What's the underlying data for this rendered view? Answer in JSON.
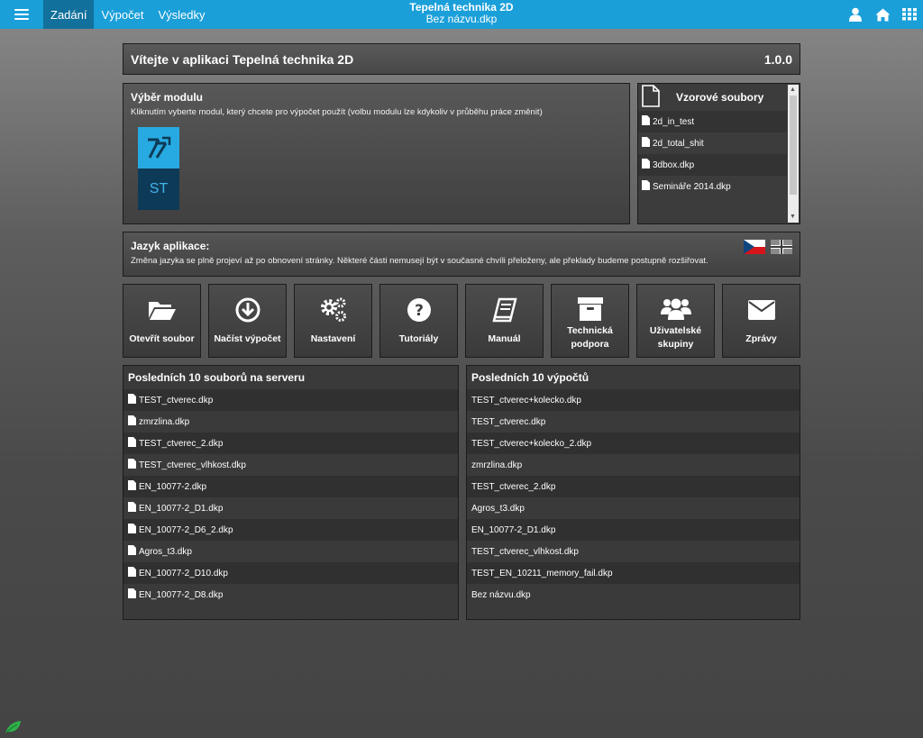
{
  "topbar": {
    "tabs": [
      {
        "label": "Zadání"
      },
      {
        "label": "Výpočet"
      },
      {
        "label": "Výsledky"
      }
    ],
    "title": "Tepelná technika 2D",
    "subtitle": "Bez názvu.dkp",
    "icons": [
      "user-icon",
      "home-icon",
      "grid-icon"
    ]
  },
  "welcome": {
    "title": "Vítejte v aplikaci Tepelná technika 2D",
    "version": "1.0.0"
  },
  "modules": {
    "title": "Výběr modulu",
    "description": "Kliknutím vyberte modul, který chcete pro výpočet použít (volbu modulu lze kdykoliv v průběhu práce změnit)",
    "tile_label": "ST"
  },
  "samples": {
    "title": "Vzorové soubory",
    "items": [
      {
        "name": "2d_in_test"
      },
      {
        "name": "2d_total_shit"
      },
      {
        "name": "3dbox.dkp"
      },
      {
        "name": "Semináře 2014.dkp"
      }
    ]
  },
  "language": {
    "title": "Jazyk aplikace:",
    "description": "Změna jazyka se plně projeví až po obnovení stránky. Některé části nemusejí být v současné chvíli přeloženy, ale překlady budeme postupně rozšiřovat."
  },
  "buttons": [
    {
      "label": "Otevřít soubor",
      "icon": "folder-open-icon"
    },
    {
      "label": "Načíst výpočet",
      "icon": "download-circle-icon"
    },
    {
      "label": "Nastavení",
      "icon": "gears-icon"
    },
    {
      "label": "Tutoriály",
      "icon": "question-circle-icon"
    },
    {
      "label": "Manuál",
      "icon": "book-icon"
    },
    {
      "label": "Technická podpora",
      "icon": "archive-box-icon"
    },
    {
      "label": "Uživatelské skupiny",
      "icon": "users-icon"
    },
    {
      "label": "Zprávy",
      "icon": "envelope-icon"
    }
  ],
  "recent_files": {
    "title": "Posledních 10 souborů na serveru",
    "items": [
      {
        "name": "TEST_ctverec.dkp"
      },
      {
        "name": "zmrzlina.dkp"
      },
      {
        "name": "TEST_ctverec_2.dkp"
      },
      {
        "name": "TEST_ctverec_vlhkost.dkp"
      },
      {
        "name": "EN_10077-2.dkp"
      },
      {
        "name": "EN_10077-2_D1.dkp"
      },
      {
        "name": "EN_10077-2_D6_2.dkp"
      },
      {
        "name": "Agros_t3.dkp"
      },
      {
        "name": "EN_10077-2_D10.dkp"
      },
      {
        "name": "EN_10077-2_D8.dkp"
      }
    ]
  },
  "recent_calcs": {
    "title": "Posledních 10 výpočtů",
    "items": [
      {
        "name": "TEST_ctverec+kolecko.dkp"
      },
      {
        "name": "TEST_ctverec.dkp"
      },
      {
        "name": "TEST_ctverec+kolecko_2.dkp"
      },
      {
        "name": "zmrzlina.dkp"
      },
      {
        "name": "TEST_ctverec_2.dkp"
      },
      {
        "name": "Agros_t3.dkp"
      },
      {
        "name": "EN_10077-2_D1.dkp"
      },
      {
        "name": "TEST_ctverec_vlhkost.dkp"
      },
      {
        "name": "TEST_EN_10211_memory_fail.dkp"
      },
      {
        "name": "Bez názvu.dkp"
      }
    ]
  },
  "colors": {
    "accent": "#1a9fd9",
    "accent_dark": "#11709c",
    "module_light": "#27aae1",
    "module_dark": "#0d3a57"
  }
}
